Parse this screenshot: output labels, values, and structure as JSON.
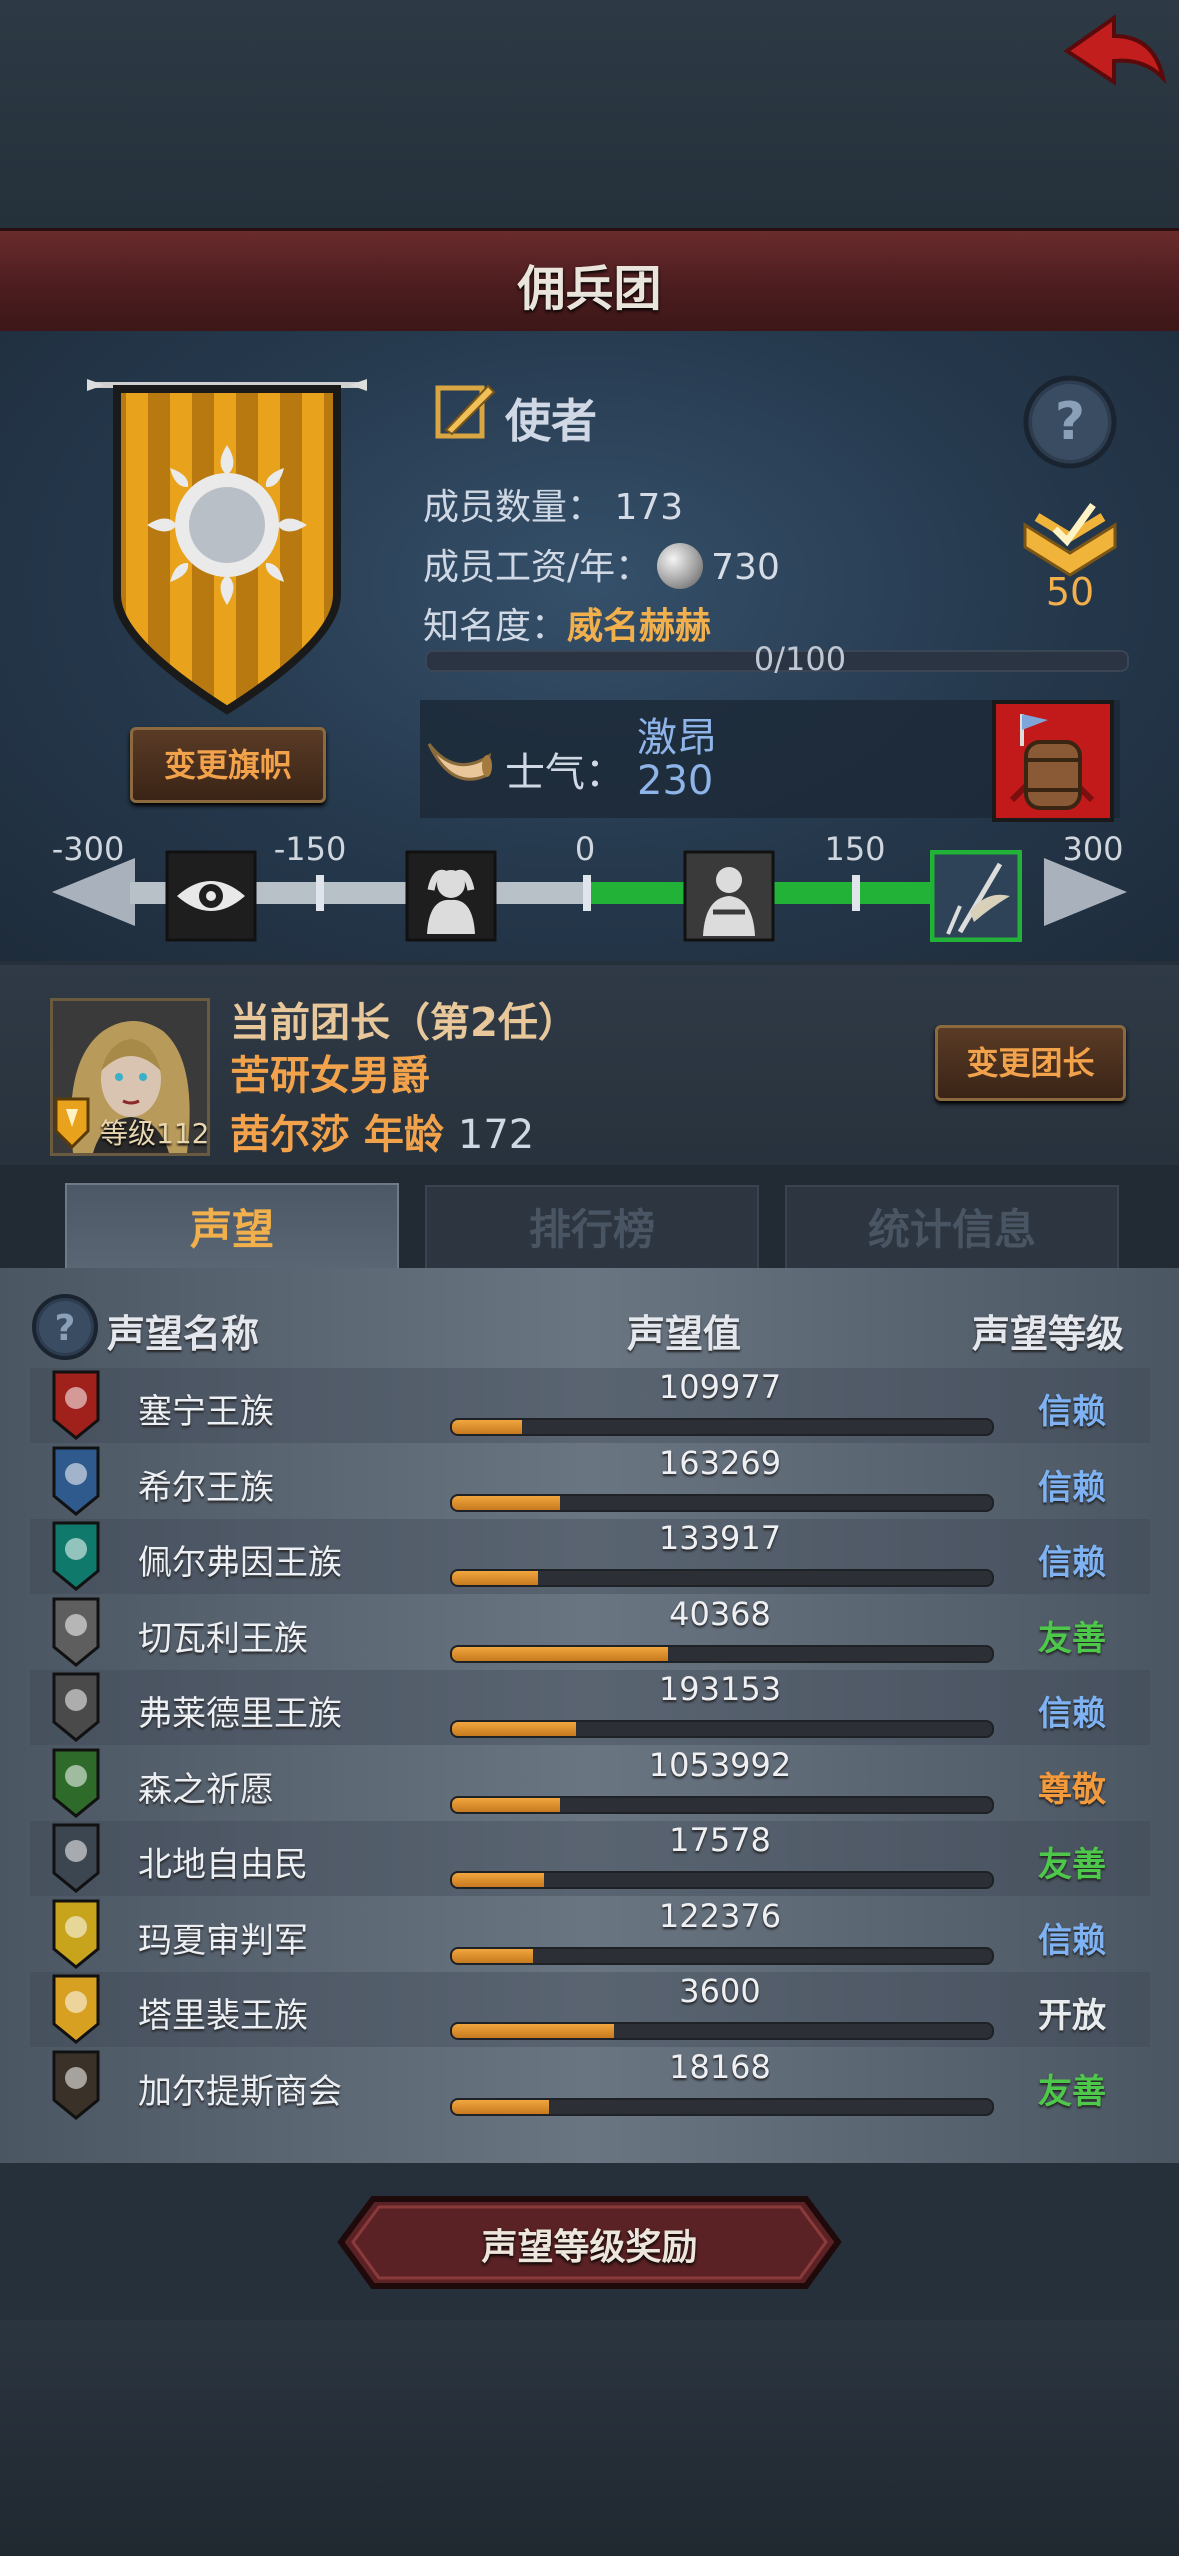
{
  "header": {
    "title": "佣兵团"
  },
  "company": {
    "role": "使者",
    "member_count_label": "成员数量：",
    "member_count": "173",
    "wage_label": "成员工资/年：",
    "wage": "730",
    "fame_label": "知名度：",
    "fame_title": "威名赫赫",
    "fame_progress": "0/100",
    "fame_fraction": 0,
    "rank_value": "50",
    "change_flag_label": "变更旗帜"
  },
  "morale": {
    "label": "士气：",
    "state": "激昂",
    "value": "230",
    "ticks": [
      "-300",
      "-150",
      "0",
      "150",
      "300"
    ]
  },
  "leader": {
    "title": "当前团长（第2任）",
    "trait": "苦研女男爵",
    "name_age": "茜尔莎  年龄",
    "age": "172",
    "level": "等级112",
    "change_label": "变更团长"
  },
  "tabs": [
    {
      "label": "声望"
    },
    {
      "label": "排行榜"
    },
    {
      "label": "统计信息"
    }
  ],
  "table": {
    "headers": {
      "name": "声望名称",
      "value": "声望值",
      "level": "声望等级"
    },
    "rows": [
      {
        "name": "塞宁王族",
        "value": "109977",
        "level": "信赖",
        "fill": 0.13,
        "emblem_color": "#a0201c",
        "level_color": "#7fb2f2"
      },
      {
        "name": "希尔王族",
        "value": "163269",
        "level": "信赖",
        "fill": 0.2,
        "emblem_color": "#2f5a8e",
        "level_color": "#7fb2f2"
      },
      {
        "name": "佩尔弗因王族",
        "value": "133917",
        "level": "信赖",
        "fill": 0.16,
        "emblem_color": "#0f7a6c",
        "level_color": "#7fb2f2"
      },
      {
        "name": "切瓦利王族",
        "value": "40368",
        "level": "友善",
        "fill": 0.4,
        "emblem_color": "#5e5e5e",
        "level_color": "#4ec84a"
      },
      {
        "name": "弗莱德里王族",
        "value": "193153",
        "level": "信赖",
        "fill": 0.23,
        "emblem_color": "#4a4a4a",
        "level_color": "#7fb2f2"
      },
      {
        "name": "森之祈愿",
        "value": "1053992",
        "level": "尊敬",
        "fill": 0.2,
        "emblem_color": "#2e6b2a",
        "level_color": "#f29a3c"
      },
      {
        "name": "北地自由民",
        "value": "17578",
        "level": "友善",
        "fill": 0.17,
        "emblem_color": "#3c4650",
        "level_color": "#4ec84a"
      },
      {
        "name": "玛夏审判军",
        "value": "122376",
        "level": "信赖",
        "fill": 0.15,
        "emblem_color": "#c8a41c",
        "level_color": "#7fb2f2"
      },
      {
        "name": "塔里裴王族",
        "value": "3600",
        "level": "开放",
        "fill": 0.3,
        "emblem_color": "#d8a020",
        "level_color": "#e8ecef"
      },
      {
        "name": "加尔提斯商会",
        "value": "18168",
        "level": "友善",
        "fill": 0.18,
        "emblem_color": "#3a3228",
        "level_color": "#4ec84a"
      }
    ]
  },
  "reward_button": {
    "label": "声望等级奖励"
  }
}
